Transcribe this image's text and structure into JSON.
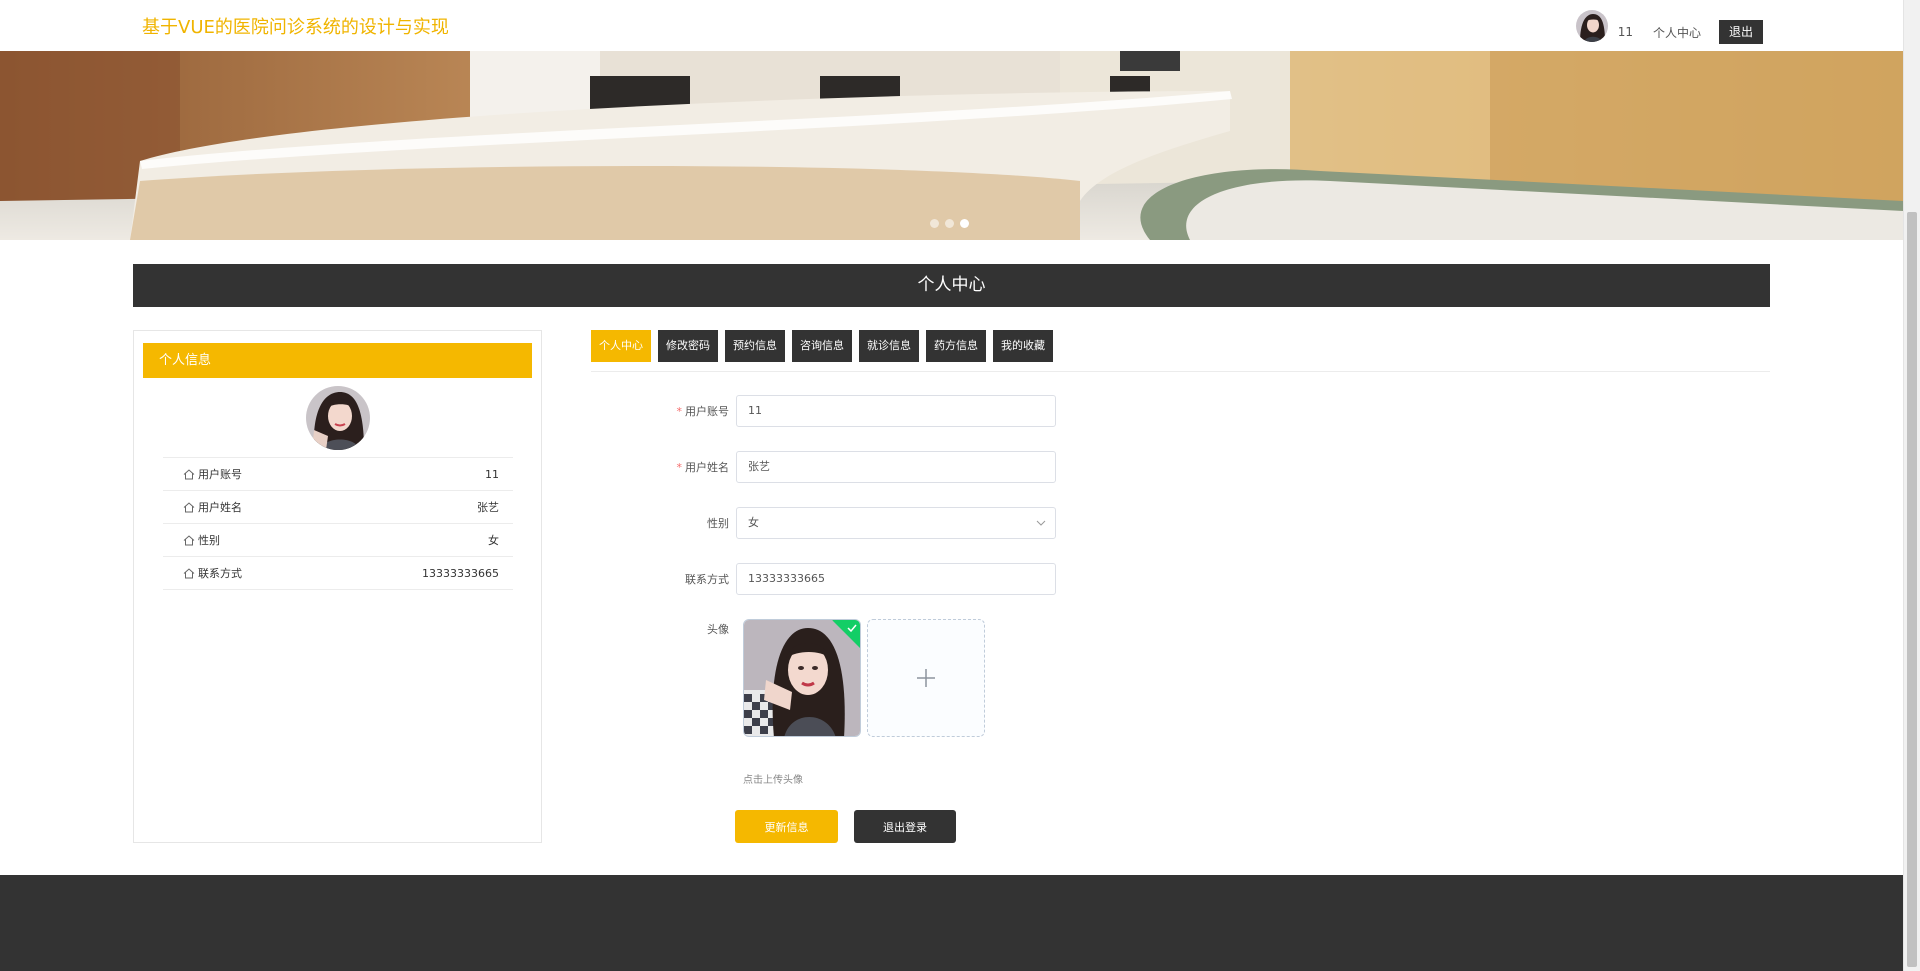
{
  "header": {
    "site_title": "基于VUE的医院问诊系统的设计与实现",
    "username": "11",
    "user_center_label": "个人中心",
    "logout_label": "退出"
  },
  "banner": {
    "slide_count": 3,
    "active_slide": 3
  },
  "section": {
    "title": "个人中心"
  },
  "left_card": {
    "title": "个人信息",
    "rows": [
      {
        "label": "用户账号",
        "value": "11"
      },
      {
        "label": "用户姓名",
        "value": "张艺"
      },
      {
        "label": "性别",
        "value": "女"
      },
      {
        "label": "联系方式",
        "value": "13333333665"
      }
    ]
  },
  "tabs": [
    {
      "label": "个人中心",
      "active": true
    },
    {
      "label": "修改密码"
    },
    {
      "label": "预约信息"
    },
    {
      "label": "咨询信息"
    },
    {
      "label": "就诊信息"
    },
    {
      "label": "药方信息"
    },
    {
      "label": "我的收藏"
    }
  ],
  "form": {
    "account": {
      "label": "用户账号",
      "value": "11",
      "required": true
    },
    "name": {
      "label": "用户姓名",
      "value": "张艺",
      "required": true
    },
    "gender": {
      "label": "性别",
      "value": "女"
    },
    "phone": {
      "label": "联系方式",
      "value": "13333333665"
    },
    "avatar": {
      "label": "头像",
      "tip": "点击上传头像"
    }
  },
  "buttons": {
    "update": "更新信息",
    "exit": "退出登录"
  },
  "colors": {
    "accent": "#f5b800",
    "dark": "#333333",
    "title": "#f0b400",
    "success": "#13ce66"
  }
}
